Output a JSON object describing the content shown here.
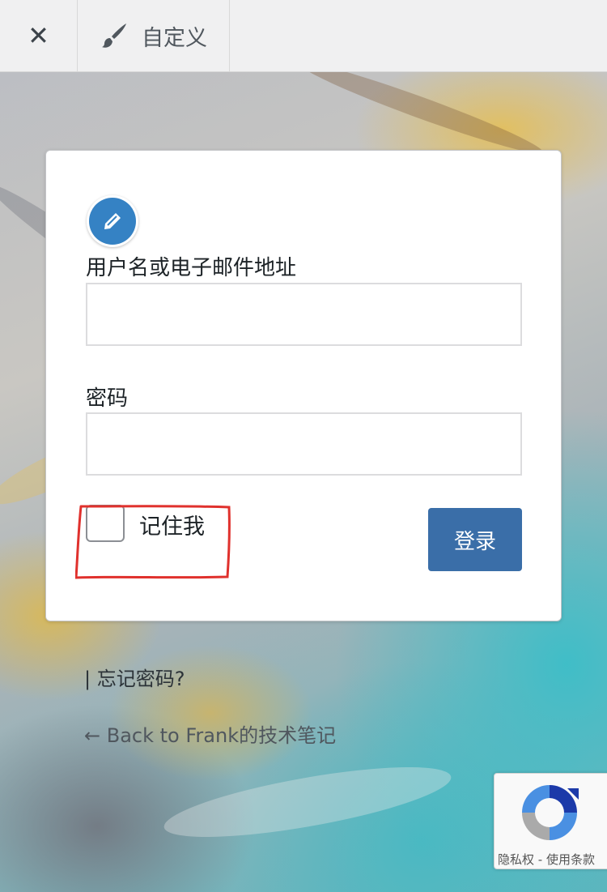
{
  "topbar": {
    "close_icon": "✕",
    "customize_label": "自定义"
  },
  "login_form": {
    "username_label": "用户名或电子邮件地址",
    "username_value": "",
    "password_label": "密码",
    "password_value": "",
    "remember_label": "记住我",
    "remember_checked": false,
    "submit_label": "登录"
  },
  "links": {
    "lost_password": "| 忘记密码?",
    "back_to_site": "← Back to Frank的技术笔记"
  },
  "recaptcha": {
    "privacy": "隐私权",
    "separator": "-",
    "terms": "使用条款"
  },
  "colors": {
    "button": "#3a6ea8",
    "edit_badge": "#3582c4",
    "annotation": "#e0312d"
  }
}
